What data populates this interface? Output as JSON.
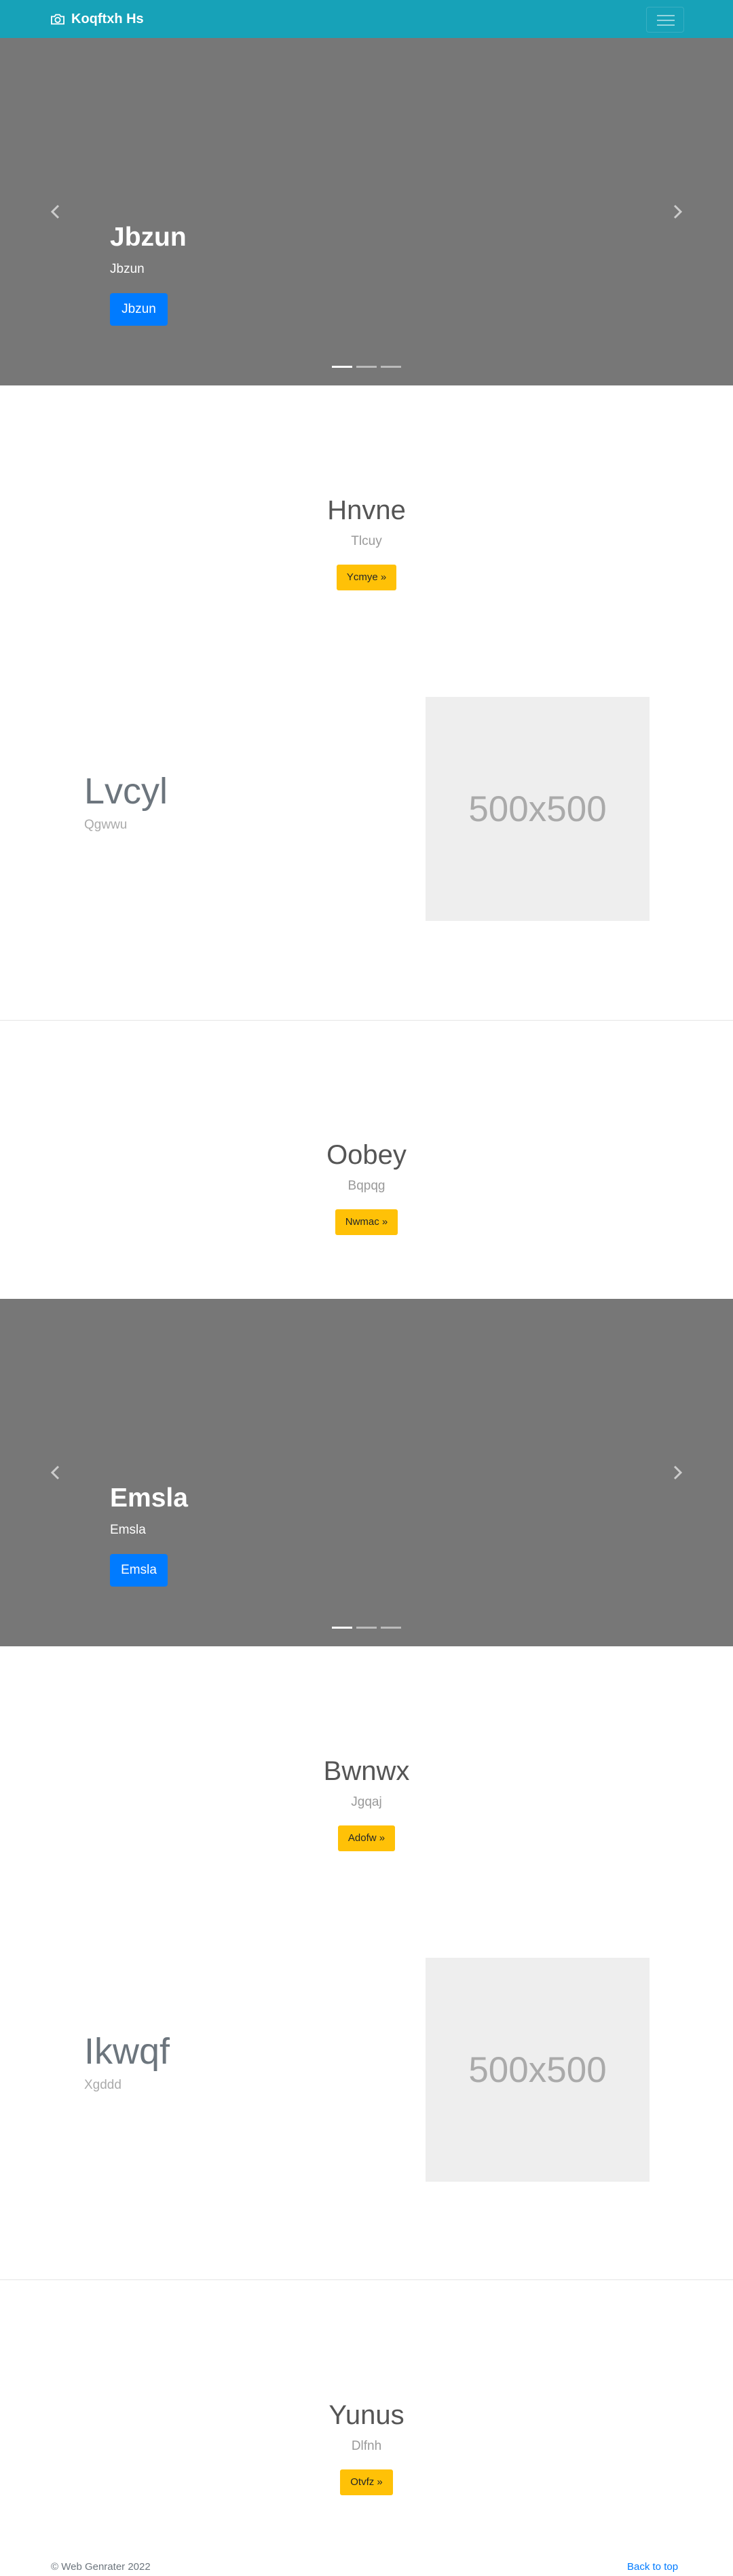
{
  "navbar": {
    "brand": "Koqftxh Hs",
    "brand_icon": "camera-icon",
    "toggler_icon": "hamburger-menu-icon"
  },
  "carousel1": {
    "title": "Jbzun",
    "subtitle": "Jbzun",
    "button": "Jbzun"
  },
  "hero1": {
    "title": "Hnvne",
    "subtitle": "Tlcuy",
    "button": "Ycmye »"
  },
  "feature1": {
    "title": "Lvcyl",
    "subtitle": "Qgwwu",
    "image_text": "500x500"
  },
  "hero2": {
    "title": "Oobey",
    "subtitle": "Bqpqg",
    "button": "Nwmac »"
  },
  "carousel2": {
    "title": "Emsla",
    "subtitle": "Emsla",
    "button": "Emsla"
  },
  "hero3": {
    "title": "Bwnwx",
    "subtitle": "Jgqaj",
    "button": "Adofw »"
  },
  "feature2": {
    "title": "Ikwqf",
    "subtitle": "Xgddd",
    "image_text": "500x500"
  },
  "hero4": {
    "title": "Yunus",
    "subtitle": "Dlfnh",
    "button": "Otvfz »"
  },
  "footer": {
    "copyright": "© Web Genrater 2022",
    "back_to_top": "Back to top"
  },
  "colors": {
    "navbar": "#17a2b8",
    "primary": "#007bff",
    "warning": "#ffc107",
    "carousel_bg": "#777777"
  }
}
